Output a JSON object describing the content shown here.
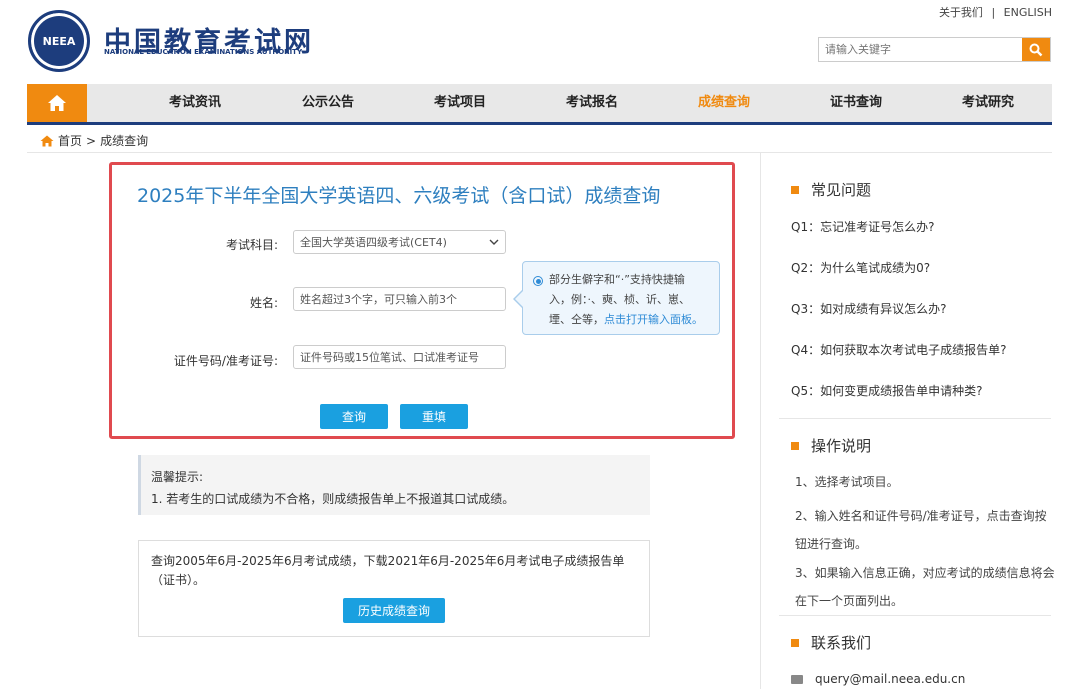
{
  "header": {
    "logo_seal_text": "NEEA",
    "logo_cn": "中国教育考试网",
    "logo_en": "NATIONAL EDUCATION EXAMINATIONS AUTHORITY",
    "about_link": "关于我们",
    "separator": "|",
    "english_link": "ENGLISH",
    "search_placeholder": "请输入关键字"
  },
  "nav": {
    "items": [
      "考试资讯",
      "公示公告",
      "考试项目",
      "考试报名",
      "成绩查询",
      "证书查询",
      "考试研究"
    ],
    "active_index": 4
  },
  "breadcrumb": {
    "home": "首页",
    "sep": ">",
    "current": "成绩查询"
  },
  "query": {
    "title": "2025年下半年全国大学英语四、六级考试（含口试）成绩查询",
    "subject_label": "考试科目:",
    "subject_value": "全国大学英语四级考试(CET4)",
    "name_label": "姓名:",
    "name_placeholder": "姓名超过3个字，可只输入前3个",
    "id_label": "证件号码/准考证号:",
    "id_placeholder": "证件号码或15位笔试、口试准考证号",
    "tip_line1": "部分生僻字和“·”支持快捷输",
    "tip_line2": "入，例：·、奭、桢、䜣、崽、",
    "tip_line3": "堙、仝等，",
    "tip_link": "点击打开输入面板。",
    "query_button": "查询",
    "reset_button": "重填"
  },
  "notice": {
    "title": "温馨提示:",
    "line1": "1. 若考生的口试成绩为不合格，则成绩报告单上不报道其口试成绩。"
  },
  "history": {
    "text": "查询2005年6月-2025年6月考试成绩，下载2021年6月-2025年6月考试电子成绩报告单（证书）。",
    "button": "历史成绩查询"
  },
  "sidebar": {
    "faq_title": "常见问题",
    "faq": [
      "Q1：忘记准考证号怎么办?",
      "Q2：为什么笔试成绩为0?",
      "Q3：如对成绩有异议怎么办?",
      "Q4：如何获取本次考试电子成绩报告单?",
      "Q5：如何变更成绩报告单申请种类?"
    ],
    "ops_title": "操作说明",
    "ops": [
      "1、选择考试项目。",
      "2、输入姓名和证件号码/准考证号，点击查询按钮进行查询。",
      "3、如果输入信息正确，对应考试的成绩信息将会在下一个页面列出。"
    ],
    "contact_title": "联系我们",
    "email": "query@mail.neea.edu.cn"
  },
  "colors": {
    "brand_blue": "#1d3d7d",
    "accent_orange": "#f08a10",
    "title_blue": "#2e7fbf",
    "highlight_red": "#e04a4f",
    "button_blue": "#1aa0e0"
  }
}
